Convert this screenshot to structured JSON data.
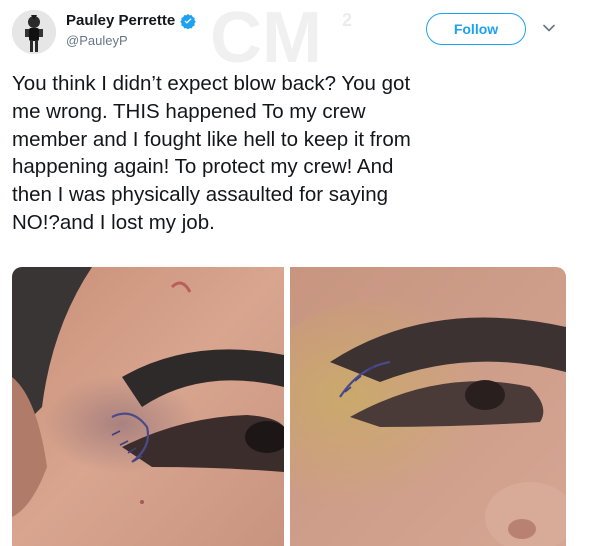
{
  "tweet": {
    "author": {
      "display_name": "Pauley Perrette",
      "handle": "@PauleyP",
      "verified": true,
      "avatar_icon": "profile-photo"
    },
    "follow_label": "Follow",
    "menu_icon": "chevron-down-icon",
    "text": "You think I didn’t expect blow back? You got\nme wrong. THIS happened To my crew\nmember and I fought like hell to keep it from\nhappening again! To protect my crew! And\nthen I was physically assaulted for saying\nNO!?and I lost my job.",
    "media": [
      {
        "description": "left-photo"
      },
      {
        "description": "right-photo"
      }
    ]
  },
  "watermark": {
    "text": "CM",
    "superscript": "2"
  },
  "colors": {
    "accent": "#1da1f2",
    "text": "#14171a",
    "secondary_text": "#657786"
  }
}
